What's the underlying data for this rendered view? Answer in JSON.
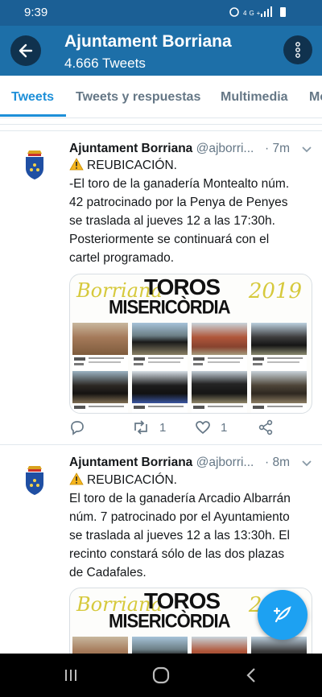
{
  "status_bar": {
    "time": "9:39",
    "network": "4G+"
  },
  "header": {
    "title": "Ajuntament Borriana",
    "subtitle": "4.666 Tweets"
  },
  "tabs": [
    {
      "label": "Tweets",
      "active": true
    },
    {
      "label": "Tweets y respuestas",
      "active": false
    },
    {
      "label": "Multimedia",
      "active": false
    },
    {
      "label": "Me",
      "active": false
    }
  ],
  "tweets": [
    {
      "name": "Ajuntament Borriana",
      "handle": "@ajborri...",
      "time": "· 7m",
      "lines": [
        "REUBICACIÓN.",
        "-El toro de la ganadería Montealto núm.",
        "42 patrocinado por la Penya de Penyes",
        "se traslada al jueves 12 a las 17:30h.",
        "Posteriormente se continuará con el",
        "cartel programado."
      ],
      "media": {
        "word1": "Borriana",
        "word2": "TOROS",
        "word3": "MISERICÒRDIA",
        "year": "2019"
      },
      "reply_count": "",
      "retweet_count": "1",
      "like_count": "1"
    },
    {
      "name": "Ajuntament Borriana",
      "handle": "@ajborri...",
      "time": "· 8m",
      "lines": [
        "REUBICACIÓN.",
        "El toro de la ganadería Arcadio Albarrán",
        "núm. 7 patrocinado por el Ayuntamiento",
        "se traslada al jueves 12 a las 13:30h. El",
        "recinto constará sólo de las dos plazas",
        "de Cadafales."
      ],
      "media": {
        "word1": "Borriana",
        "word2": "TOROS",
        "word3": "MISERICÒRDIA",
        "year": "2019"
      }
    }
  ],
  "colors": {
    "header": "#1d6fa8",
    "status": "#1b5f95",
    "accent": "#1da1f2",
    "text_secondary": "#657786"
  }
}
